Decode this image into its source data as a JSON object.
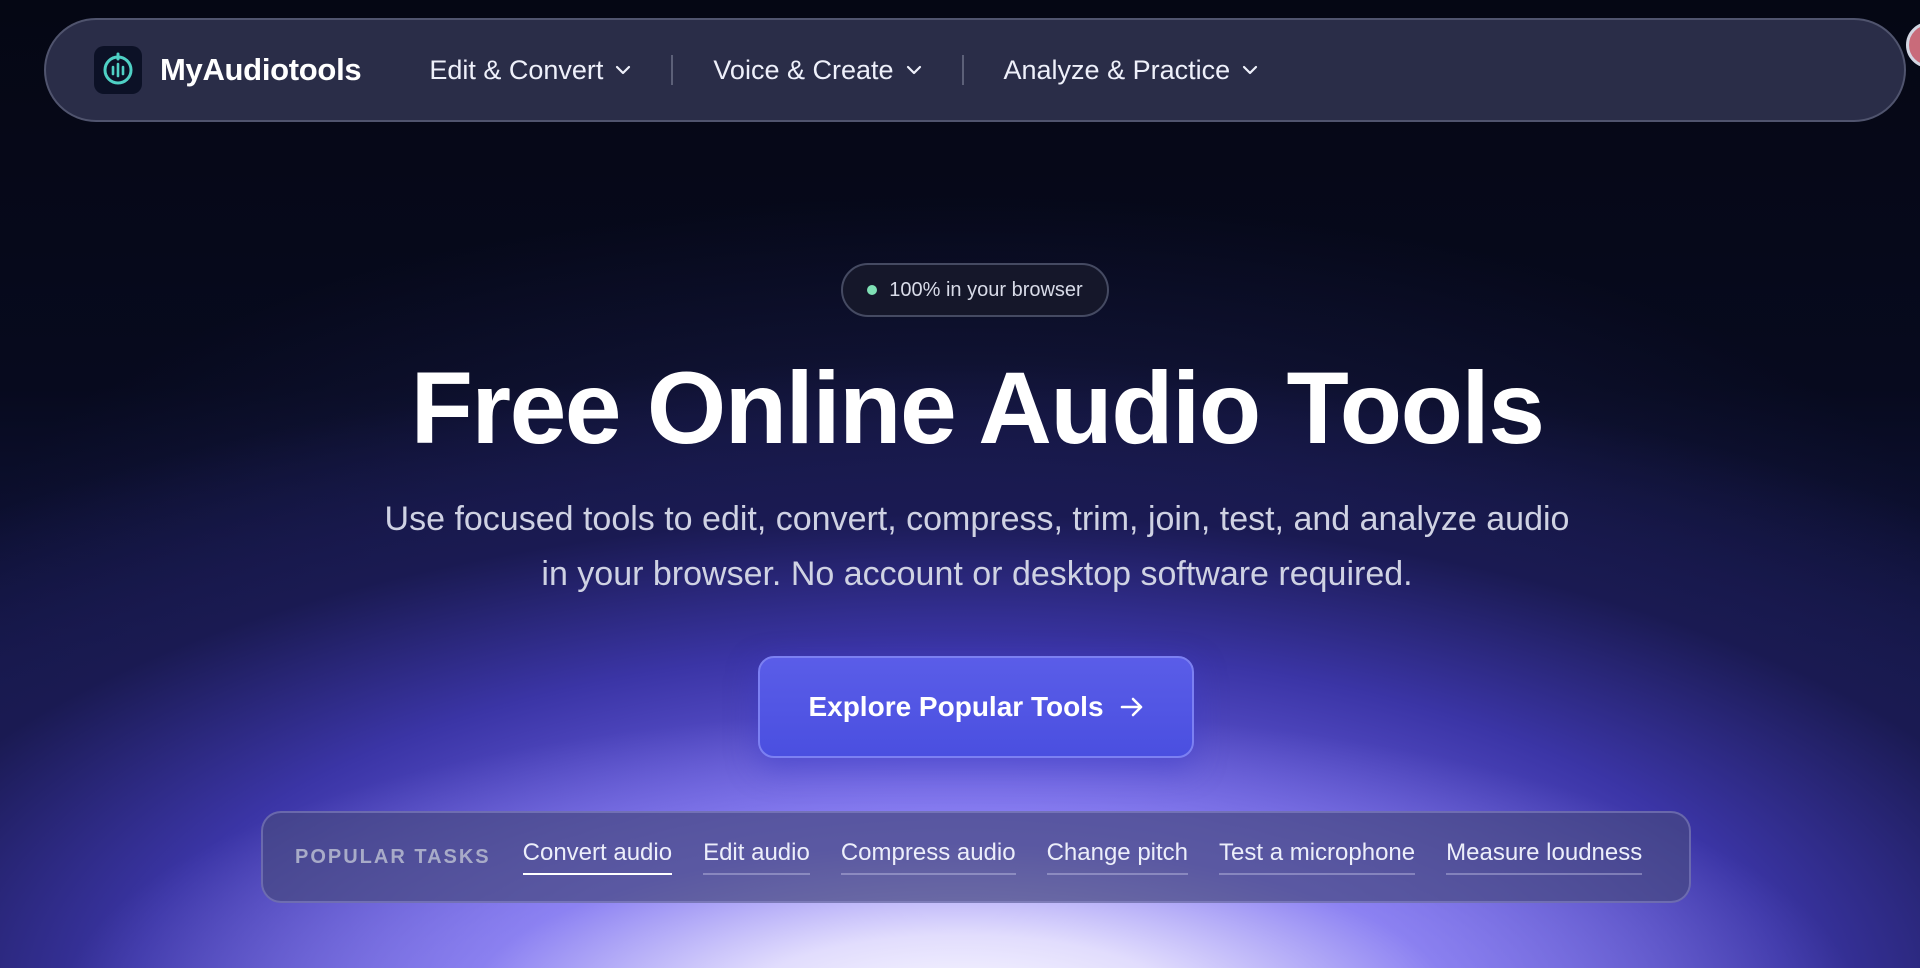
{
  "brand": {
    "name": "MyAudiotools",
    "logo_icon": "audio-wave-logo-icon"
  },
  "nav": {
    "items": [
      {
        "label": "Edit & Convert"
      },
      {
        "label": "Voice & Create"
      },
      {
        "label": "Analyze & Practice"
      }
    ]
  },
  "hero": {
    "badge": "100% in your browser",
    "title": "Free Online Audio Tools",
    "subtitle": "Use focused tools to edit, convert, compress, trim, join, test, and analyze audio in your browser. No account or desktop software required.",
    "cta_label": "Explore Popular Tools"
  },
  "popular_tasks": {
    "label": "POPULAR TASKS",
    "items": [
      {
        "label": "Convert audio",
        "active": true
      },
      {
        "label": "Edit audio"
      },
      {
        "label": "Compress audio"
      },
      {
        "label": "Change pitch"
      },
      {
        "label": "Test a microphone"
      },
      {
        "label": "Measure loudness"
      }
    ]
  },
  "colors": {
    "accent": "#4f53e3",
    "badge_dot": "#7fe0b5",
    "logo_accent": "#4fd1c5"
  }
}
